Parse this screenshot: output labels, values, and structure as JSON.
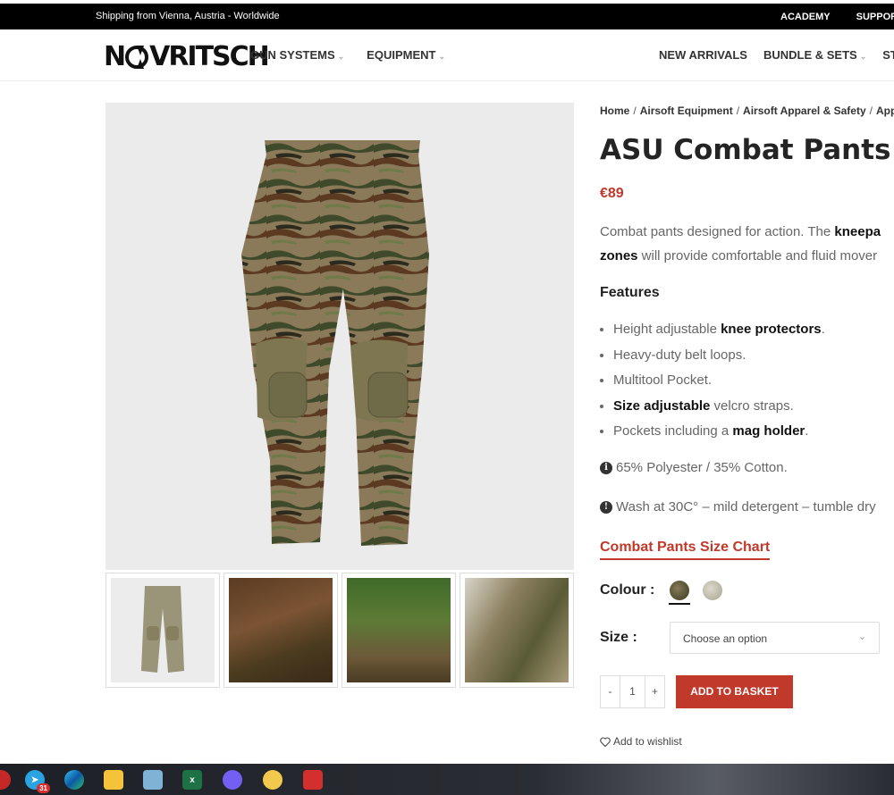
{
  "topbar": {
    "shipping": "Shipping from Vienna, Austria - Worldwide",
    "links": [
      "ACADEMY",
      "SUPPOR"
    ]
  },
  "header": {
    "logo_text": "NOVRITSCH",
    "logo_left": "N",
    "logo_right": "VRITSCH",
    "nav_left": [
      {
        "label": "GUN SYSTEMS",
        "has_dropdown": true
      },
      {
        "label": "EQUIPMENT",
        "has_dropdown": true
      }
    ],
    "nav_right": [
      {
        "label": "NEW ARRIVALS",
        "has_dropdown": false
      },
      {
        "label": "BUNDLE & SETS",
        "has_dropdown": true
      },
      {
        "label": "STAR",
        "has_dropdown": false
      }
    ]
  },
  "breadcrumb": [
    "Home",
    "Airsoft Equipment",
    "Airsoft Apparel & Safety",
    "Appa"
  ],
  "product": {
    "title": "ASU Combat Pants",
    "price": "€89",
    "desc_line1_a": "Combat pants designed for action. The ",
    "desc_line1_b": "kneepa",
    "desc_line2_a": "zones",
    "desc_line2_b": " will provide comfortable and fluid mover",
    "features_heading": "Features",
    "features": [
      {
        "pre": "Height adjustable ",
        "bold": "knee protectors",
        "post": "."
      },
      {
        "pre": "Heavy-duty belt loops.",
        "bold": "",
        "post": ""
      },
      {
        "pre": "Multitool Pocket.",
        "bold": "",
        "post": ""
      },
      {
        "pre": "",
        "bold": "Size adjustable",
        "post": " velcro straps."
      },
      {
        "pre": "Pockets including a ",
        "bold": "mag holder",
        "post": "."
      }
    ],
    "material": "65% Polyester / 35% Cotton.",
    "wash": "Wash at 30C° – mild detergent – tumble dry",
    "size_chart": "Combat Pants Size Chart",
    "colour_label": "Colour :",
    "size_label": "Size :",
    "size_placeholder": "Choose an option",
    "qty_minus": "-",
    "qty_value": "1",
    "qty_plus": "+",
    "add_to_basket": "ADD TO BASKET",
    "wishlist": "Add to wishlist"
  },
  "colours": {
    "accent": "#c0392b",
    "swatch_camo": "#6b6048",
    "swatch_grey": "#c9c6bc"
  },
  "taskbar": {
    "icons": [
      "telegram-icon",
      "edge-icon",
      "file-explorer-icon",
      "notepad-icon",
      "excel-icon",
      "viber-icon",
      "1c-icon",
      "acrobat-icon"
    ],
    "telegram_badge": "31",
    "excel_letter": "x"
  }
}
